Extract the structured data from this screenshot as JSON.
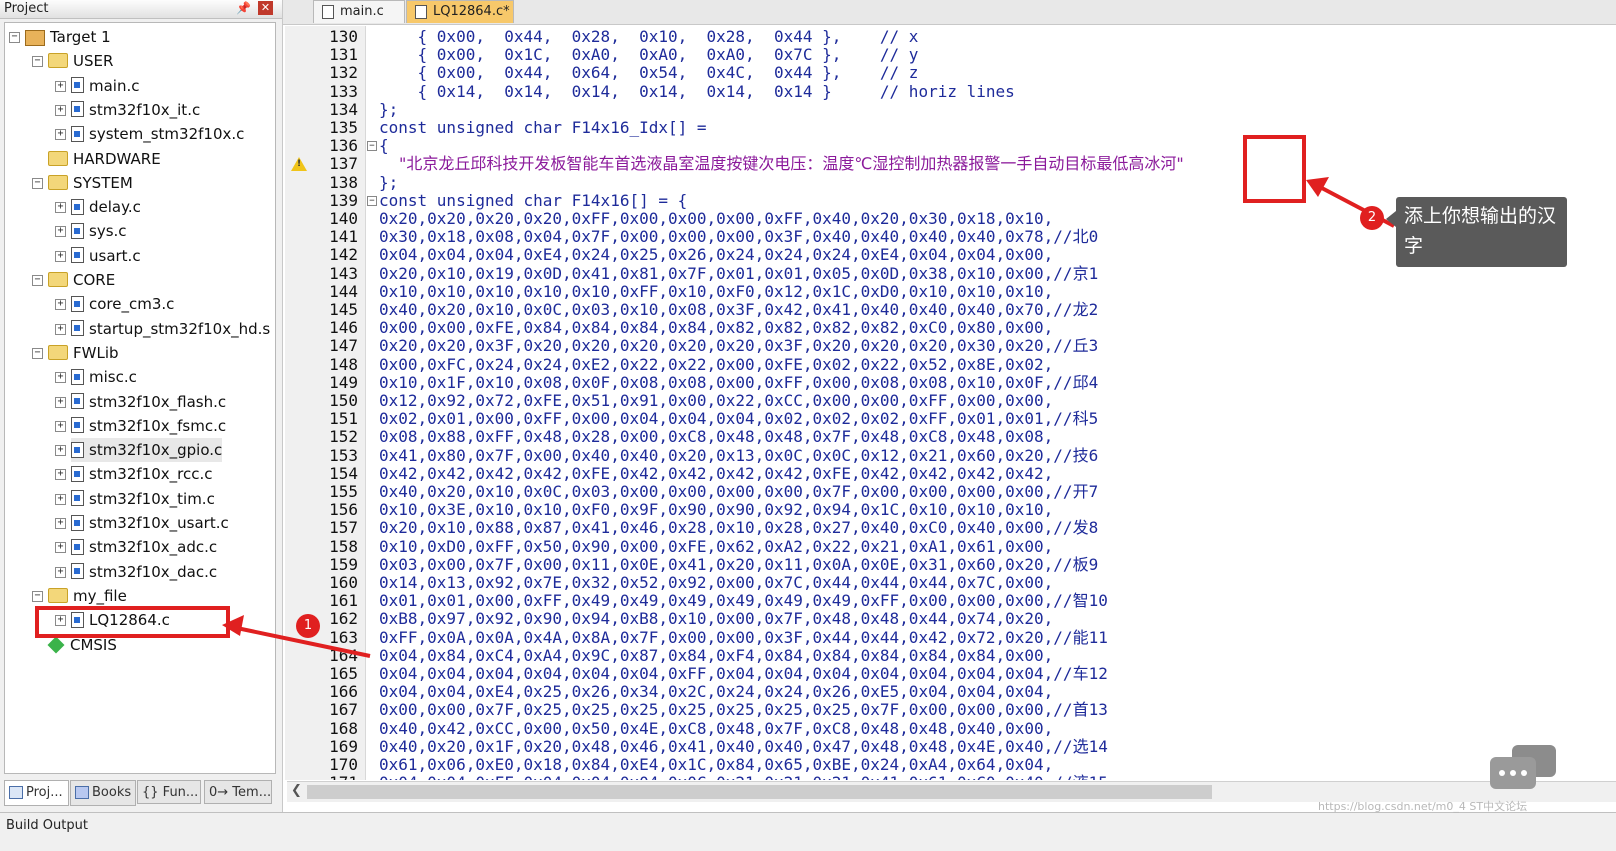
{
  "project_pane": {
    "title": "Project",
    "pin_icon": "pin-icon",
    "close_icon": "close-icon",
    "tree": [
      {
        "label": "Target 1",
        "kind": "target"
      },
      {
        "label": "USER",
        "kind": "folder"
      },
      {
        "label": "main.c",
        "kind": "file"
      },
      {
        "label": "stm32f10x_it.c",
        "kind": "file"
      },
      {
        "label": "system_stm32f10x.c",
        "kind": "file"
      },
      {
        "label": "HARDWARE",
        "kind": "folder"
      },
      {
        "label": "SYSTEM",
        "kind": "folder"
      },
      {
        "label": "delay.c",
        "kind": "file"
      },
      {
        "label": "sys.c",
        "kind": "file"
      },
      {
        "label": "usart.c",
        "kind": "file"
      },
      {
        "label": "CORE",
        "kind": "folder"
      },
      {
        "label": "core_cm3.c",
        "kind": "file"
      },
      {
        "label": "startup_stm32f10x_hd.s",
        "kind": "file"
      },
      {
        "label": "FWLib",
        "kind": "folder"
      },
      {
        "label": "misc.c",
        "kind": "file"
      },
      {
        "label": "stm32f10x_flash.c",
        "kind": "file"
      },
      {
        "label": "stm32f10x_fsmc.c",
        "kind": "file"
      },
      {
        "label": "stm32f10x_gpio.c",
        "kind": "file"
      },
      {
        "label": "stm32f10x_rcc.c",
        "kind": "file"
      },
      {
        "label": "stm32f10x_tim.c",
        "kind": "file"
      },
      {
        "label": "stm32f10x_usart.c",
        "kind": "file"
      },
      {
        "label": "stm32f10x_adc.c",
        "kind": "file"
      },
      {
        "label": "stm32f10x_dac.c",
        "kind": "file"
      },
      {
        "label": "my_file",
        "kind": "folder"
      },
      {
        "label": "LQ12864.c",
        "kind": "file"
      },
      {
        "label": "CMSIS",
        "kind": "cmsis"
      }
    ],
    "bottom_tabs": [
      "Proj...",
      "Books",
      "{} Fun...",
      "0→ Tem..."
    ]
  },
  "build_output": {
    "title": "Build Output"
  },
  "editor": {
    "tabs": [
      {
        "label": "main.c",
        "active": false
      },
      {
        "label": "LQ12864.c*",
        "active": true
      }
    ],
    "line_numbers": [
      "130",
      "131",
      "132",
      "133",
      "134",
      "135",
      "136",
      "137",
      "138",
      "139",
      "140",
      "141",
      "142",
      "143",
      "144",
      "145",
      "146",
      "147",
      "148",
      "149",
      "150",
      "151",
      "152",
      "153",
      "154",
      "155",
      "156",
      "157",
      "158",
      "159",
      "160",
      "161",
      "162",
      "163",
      "164",
      "165",
      "166",
      "167",
      "168",
      "169",
      "170",
      "171"
    ],
    "lines": [
      "    { 0x00,  0x44,  0x28,  0x10,  0x28,  0x44 },    // x",
      "    { 0x00,  0x1C,  0xA0,  0xA0,  0xA0,  0x7C },    // y",
      "    { 0x00,  0x44,  0x64,  0x54,  0x4C,  0x44 },    // z",
      "    { 0x14,  0x14,  0x14,  0x14,  0x14,  0x14 }     // horiz lines",
      "};",
      "const unsigned char F14x16_Idx[] =",
      "{",
      "",
      "};",
      "const unsigned char F14x16[] = {",
      "0x20,0x20,0x20,0x20,0xFF,0x00,0x00,0x00,0xFF,0x40,0x20,0x30,0x18,0x10,",
      "0x30,0x18,0x08,0x04,0x7F,0x00,0x00,0x00,0x3F,0x40,0x40,0x40,0x40,0x78,//北0",
      "0x04,0x04,0x04,0xE4,0x24,0x25,0x26,0x24,0x24,0x24,0xE4,0x04,0x04,0x00,",
      "0x20,0x10,0x19,0x0D,0x41,0x81,0x7F,0x01,0x01,0x05,0x0D,0x38,0x10,0x00,//京1",
      "0x10,0x10,0x10,0x10,0x10,0xFF,0x10,0xF0,0x12,0x1C,0xD0,0x10,0x10,0x10,",
      "0x40,0x20,0x10,0x0C,0x03,0x10,0x08,0x3F,0x42,0x41,0x40,0x40,0x40,0x70,//龙2",
      "0x00,0x00,0xFE,0x84,0x84,0x84,0x84,0x82,0x82,0x82,0x82,0xC0,0x80,0x00,",
      "0x20,0x20,0x3F,0x20,0x20,0x20,0x20,0x20,0x3F,0x20,0x20,0x20,0x30,0x20,//丘3",
      "0x00,0xFC,0x24,0x24,0xE2,0x22,0x22,0x00,0xFE,0x02,0x22,0x52,0x8E,0x02,",
      "0x10,0x1F,0x10,0x08,0x0F,0x08,0x08,0x00,0xFF,0x00,0x08,0x08,0x10,0x0F,//邱4",
      "0x12,0x92,0x72,0xFE,0x51,0x91,0x00,0x22,0xCC,0x00,0x00,0xFF,0x00,0x00,",
      "0x02,0x01,0x00,0xFF,0x00,0x04,0x04,0x04,0x02,0x02,0x02,0xFF,0x01,0x01,//科5",
      "0x08,0x88,0xFF,0x48,0x28,0x00,0xC8,0x48,0x48,0x7F,0x48,0xC8,0x48,0x08,",
      "0x41,0x80,0x7F,0x00,0x40,0x40,0x20,0x13,0x0C,0x0C,0x12,0x21,0x60,0x20,//技6",
      "0x42,0x42,0x42,0x42,0xFE,0x42,0x42,0x42,0x42,0xFE,0x42,0x42,0x42,0x42,",
      "0x40,0x20,0x10,0x0C,0x03,0x00,0x00,0x00,0x00,0x7F,0x00,0x00,0x00,0x00,//开7",
      "0x10,0x3E,0x10,0x10,0xF0,0x9F,0x90,0x90,0x92,0x94,0x1C,0x10,0x10,0x10,",
      "0x20,0x10,0x88,0x87,0x41,0x46,0x28,0x10,0x28,0x27,0x40,0xC0,0x40,0x00,//发8",
      "0x10,0xD0,0xFF,0x50,0x90,0x00,0xFE,0x62,0xA2,0x22,0x21,0xA1,0x61,0x00,",
      "0x03,0x00,0x7F,0x00,0x11,0x0E,0x41,0x20,0x11,0x0A,0x0E,0x31,0x60,0x20,//板9",
      "0x14,0x13,0x92,0x7E,0x32,0x52,0x92,0x00,0x7C,0x44,0x44,0x44,0x7C,0x00,",
      "0x01,0x01,0x00,0xFF,0x49,0x49,0x49,0x49,0x49,0x49,0xFF,0x00,0x00,0x00,//智10",
      "0xB8,0x97,0x92,0x90,0x94,0xB8,0x10,0x00,0x7F,0x48,0x48,0x44,0x74,0x20,",
      "0xFF,0x0A,0x0A,0x4A,0x8A,0x7F,0x00,0x00,0x3F,0x44,0x44,0x42,0x72,0x20,//能11",
      "0x04,0x84,0xC4,0xA4,0x9C,0x87,0x84,0xF4,0x84,0x84,0x84,0x84,0x84,0x00,",
      "0x04,0x04,0x04,0x04,0x04,0x04,0xFF,0x04,0x04,0x04,0x04,0x04,0x04,0x04,//车12",
      "0x04,0x04,0xE4,0x25,0x26,0x34,0x2C,0x24,0x24,0x26,0xE5,0x04,0x04,0x04,",
      "0x00,0x00,0x7F,0x25,0x25,0x25,0x25,0x25,0x25,0x25,0x7F,0x00,0x00,0x00,//首13",
      "0x40,0x42,0xCC,0x00,0x50,0x4E,0xC8,0x48,0x7F,0xC8,0x48,0x48,0x40,0x00,",
      "0x40,0x20,0x1F,0x20,0x48,0x46,0x41,0x40,0x40,0x47,0x48,0x48,0x4E,0x40,//选14",
      "0x61,0x06,0xE0,0x18,0x84,0xE4,0x1C,0x84,0x65,0xBE,0x24,0xA4,0x64,0x04,",
      "0x04,0x04,0xFF,0x04,0x04,0x04,0x0C,0x21,0x21,0x21,0x41,0x61,0xC0,0x40,//液15"
    ],
    "index_string": "\"北京龙丘邱科技开发板智能车首选液晶室温度按键次电压：温度℃湿控制加热器报警一手自动目标最低高冰河\"",
    "warning_icon": "warning-icon"
  },
  "annotations": {
    "badge1": "1",
    "badge2": "2",
    "tooltip": "添上你想输出的汉字",
    "watermark": "https://blog.csdn.net/m0_4 ST中文论坛",
    "chat_icon": "chat-bubble-icon",
    "accent_color": "#e02020"
  }
}
